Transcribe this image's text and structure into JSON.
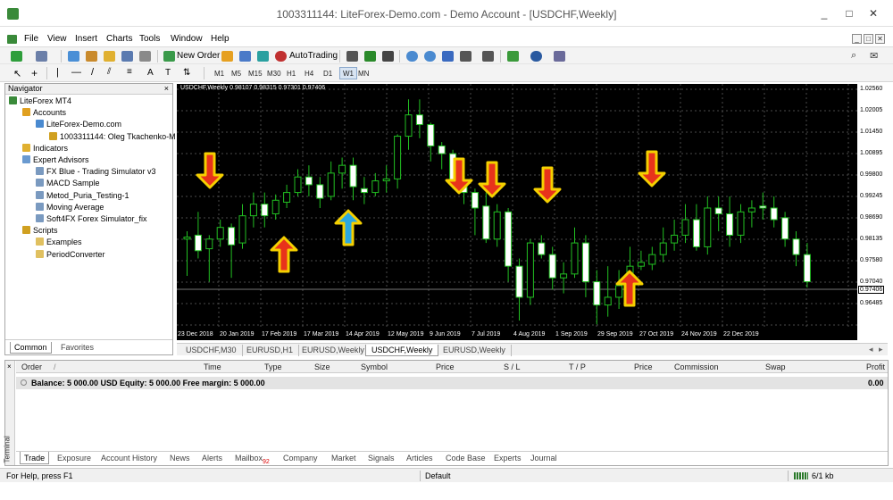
{
  "window": {
    "title": "1003311144: LiteForex-Demo.com - Demo Account - [USDCHF,Weekly]",
    "controls": [
      "_",
      "□",
      "✕"
    ]
  },
  "menu": {
    "items": [
      "File",
      "View",
      "Insert",
      "Charts",
      "Tools",
      "Window",
      "Help"
    ]
  },
  "toolbar": {
    "new_order": "New Order",
    "autotrading": "AutoTrading",
    "timeframes": [
      "M1",
      "M5",
      "M15",
      "M30",
      "H1",
      "H4",
      "D1",
      "W1",
      "MN"
    ]
  },
  "navigator": {
    "title": "Navigator",
    "close": "×",
    "items": [
      {
        "label": "LiteForex MT4",
        "level": 0,
        "icon": "mt4-icon"
      },
      {
        "label": "Accounts",
        "level": 1,
        "icon": "accounts-icon"
      },
      {
        "label": "LiteForex-Demo.com",
        "level": 2,
        "icon": "server-icon"
      },
      {
        "label": "1003311144: Oleg Tkachenko-M",
        "level": 3,
        "icon": "user-icon"
      },
      {
        "label": "Indicators",
        "level": 1,
        "icon": "indicators-icon"
      },
      {
        "label": "Expert Advisors",
        "level": 1,
        "icon": "expert-icon"
      },
      {
        "label": "FX Blue - Trading Simulator v3",
        "level": 2,
        "icon": "ea-icon"
      },
      {
        "label": "MACD Sample",
        "level": 2,
        "icon": "ea-icon"
      },
      {
        "label": "Metod_Puria_Testing-1",
        "level": 2,
        "icon": "ea-icon"
      },
      {
        "label": "Moving Average",
        "level": 2,
        "icon": "ea-icon"
      },
      {
        "label": "Soft4FX Forex Simulator_fix",
        "level": 2,
        "icon": "ea-icon"
      },
      {
        "label": "Scripts",
        "level": 1,
        "icon": "scripts-icon"
      },
      {
        "label": "Examples",
        "level": 2,
        "icon": "folder-icon"
      },
      {
        "label": "PeriodConverter",
        "level": 2,
        "icon": "script-icon"
      }
    ],
    "tabs": [
      "Common",
      "Favorites"
    ]
  },
  "chart": {
    "header": "USDCHF,Weekly  0.98107 0.98315 0.97301 0.97406",
    "price_labels": [
      "1.02560",
      "1.02005",
      "1.01450",
      "1.00895",
      "0.99800",
      "0.99245",
      "0.98690",
      "0.98135",
      "0.97580",
      "0.97040",
      "0.96485"
    ],
    "current_price": "0.97406",
    "time_labels": [
      "23 Dec 2018",
      "20 Jan 2019",
      "17 Feb 2019",
      "17 Mar 2019",
      "14 Apr 2019",
      "12 May 2019",
      "9 Jun 2019",
      "7 Jul 2019",
      "4 Aug 2019",
      "1 Sep 2019",
      "29 Sep 2019",
      "27 Oct 2019",
      "24 Nov 2019",
      "22 Dec 2019"
    ],
    "colors": {
      "bg": "#000000",
      "grid": "#4a4a4a",
      "bull": "#000000",
      "bear": "#ffffff",
      "wick": "#22c022",
      "arrow_red": "#e8331b",
      "arrow_blue": "#2ba8e0",
      "arrow_outline": "#f5d000"
    }
  },
  "chart_tabs": [
    "USDCHF,M30",
    "EURUSD,H1",
    "EURUSD,Weekly",
    "USDCHF,Weekly",
    "EURUSD,Weekly"
  ],
  "chart_tabs_active": 3,
  "chart_tabs_arrows": [
    "◂",
    "▸"
  ],
  "terminal": {
    "side_label": "Terminal",
    "columns": [
      "Order",
      "/",
      "Time",
      "Type",
      "Size",
      "Symbol",
      "Price",
      "S / L",
      "T / P",
      "Price",
      "Commission",
      "Swap",
      "Profit"
    ],
    "balance_text": "Balance: 5 000.00 USD  Equity: 5 000.00  Free margin: 5 000.00",
    "profit_total": "0.00",
    "tabs": [
      "Trade",
      "Exposure",
      "Account History",
      "News",
      "Alerts",
      "Mailbox",
      "Company",
      "Market",
      "Signals",
      "Articles",
      "Code Base",
      "Experts",
      "Journal"
    ],
    "mailbox_badge": "92"
  },
  "status": {
    "help": "For Help, press F1",
    "profile": "Default",
    "traffic": "6/1 kb"
  }
}
